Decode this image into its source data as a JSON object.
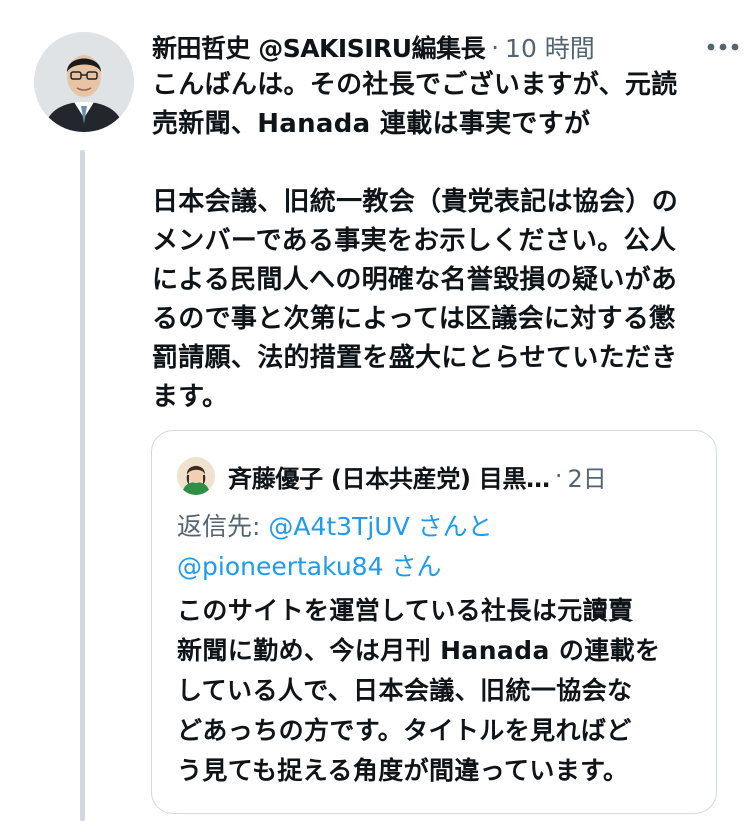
{
  "tweet": {
    "author_name": "新田哲史 @SAKISIRU編集長",
    "separator": "·",
    "time": "10 時間",
    "avatar_icon": "person-photo-icon",
    "more_icon": "more-horizontal-icon",
    "text_lines": [
      "こんばんは。その社長でございますが、元読",
      "売新聞、Hanada 連載は事実ですが",
      "",
      "日本会議、旧統一教会（貴党表記は協会）の",
      "メンバーである事実をお示しください。公人",
      "による民間人への明確な名誉毀損の疑いがあ",
      "るので事と次第によっては区議会に対する懲",
      "罰請願、法的措置を盛大にとらせていただき",
      "ます。"
    ]
  },
  "quoted": {
    "author_name": "斉藤優子 (日本共産党) 目黒…",
    "separator": "·",
    "time": "2日",
    "reply_label": "返信先: ",
    "mention_1": "@A4t3TjUV",
    "joiner": " さんと",
    "mention_2": "@pioneertaku84",
    "suffix": " さん",
    "text_lines": [
      "このサイトを運営している社長は元讀賣",
      "新聞に勤め、今は月刊 Hanada の連載を",
      "している人で、日本会議、旧統一協会な",
      "どあっちの方です。タイトルを見ればど",
      "う見ても捉える角度が間違っています。"
    ]
  },
  "colors": {
    "text": "#0f1419",
    "secondary": "#536471",
    "link": "#1d9bf0",
    "border": "#cfd9de"
  }
}
